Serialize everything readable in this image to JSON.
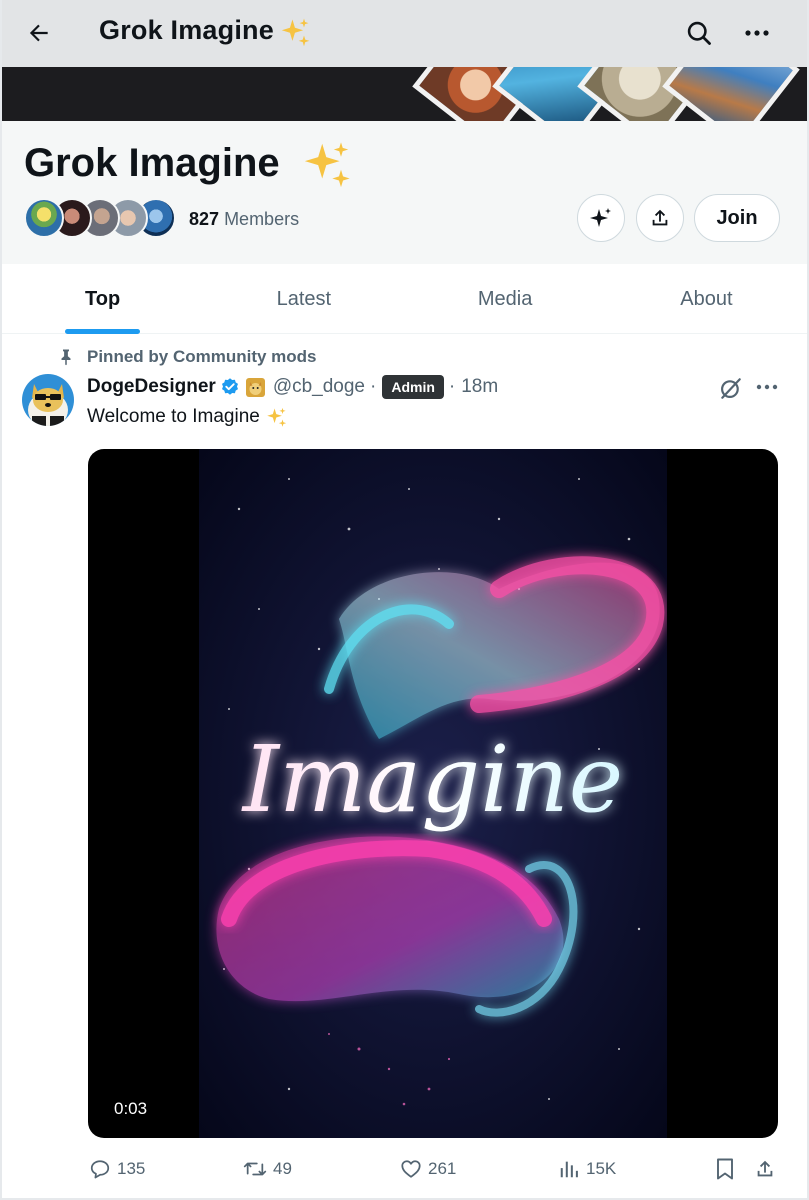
{
  "topbar": {
    "title": "Grok Imagine",
    "back_icon": "arrow-left-icon",
    "search_icon": "search-icon",
    "more_icon": "more-horizontal-icon"
  },
  "header": {
    "community_name": "Grok Imagine",
    "members_count": "827",
    "members_label": "Members",
    "join_label": "Join",
    "grok_button_icon": "sparkle-icon",
    "share_button_icon": "share-icon"
  },
  "tabs": [
    {
      "label": "Top",
      "active": true
    },
    {
      "label": "Latest",
      "active": false
    },
    {
      "label": "Media",
      "active": false
    },
    {
      "label": "About",
      "active": false
    }
  ],
  "post": {
    "pinned_label": "Pinned by Community mods",
    "author_name": "DogeDesigner",
    "handle": "@cb_doge",
    "separator": "·",
    "role_badge": "Admin",
    "time": "18m",
    "text": "Welcome to Imagine",
    "media": {
      "type": "video",
      "artwork_text": "Imagine",
      "duration": "0:03"
    },
    "stats": {
      "replies": "135",
      "reposts": "49",
      "likes": "261",
      "views": "15K"
    }
  },
  "colors": {
    "accent": "#1d9bf0",
    "text": "#0f1419",
    "muted": "#536471",
    "admin_badge": "#2f3336"
  }
}
